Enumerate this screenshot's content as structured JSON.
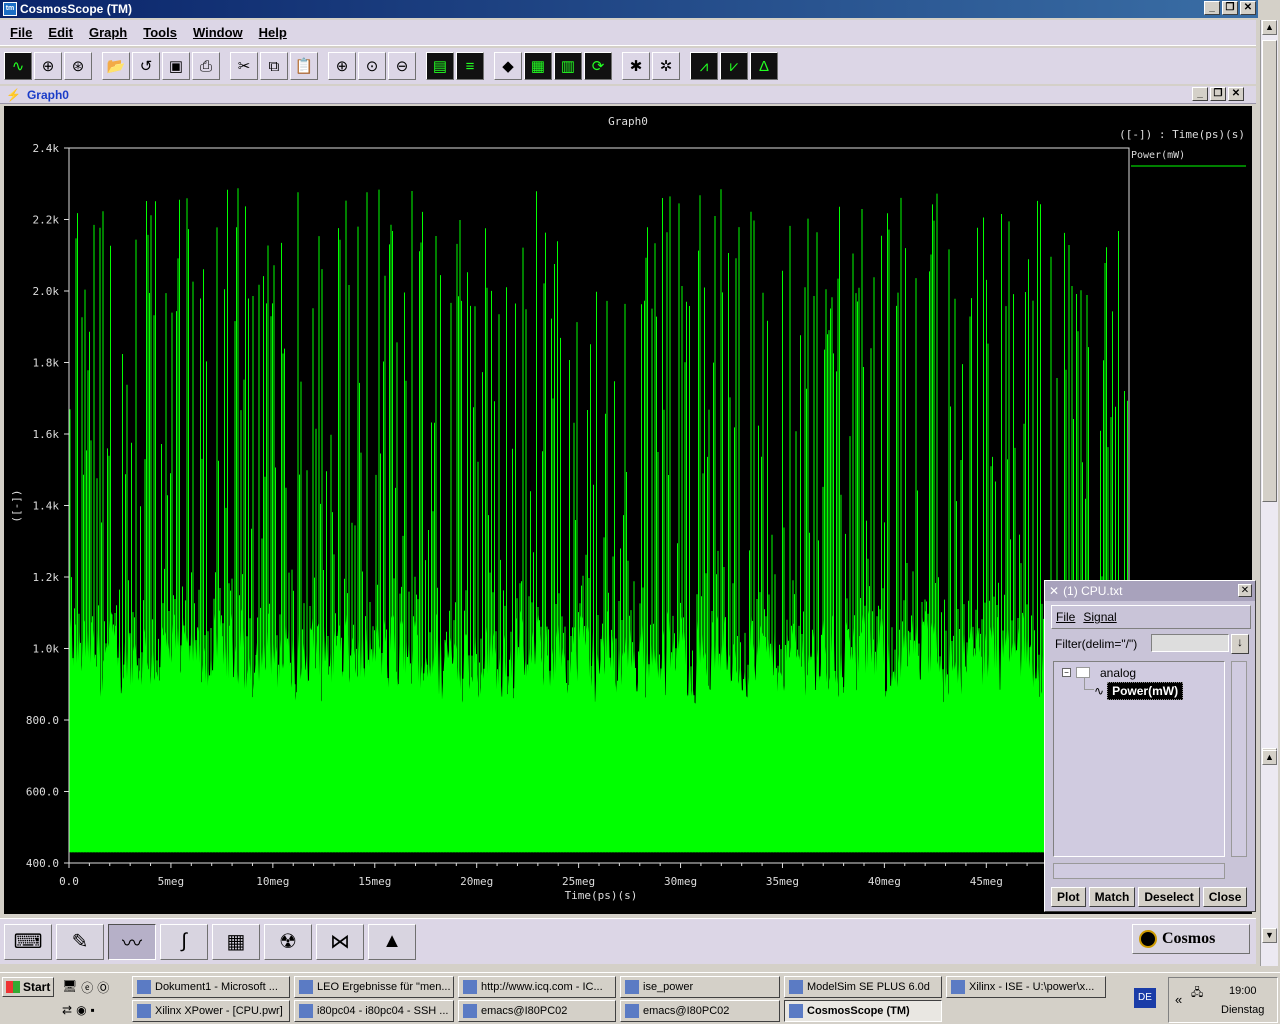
{
  "app": {
    "title": "CosmosScope (TM)",
    "icon_label": "tm"
  },
  "menu": [
    "File",
    "Edit",
    "Graph",
    "Tools",
    "Window",
    "Help"
  ],
  "toolbar": {
    "icons": [
      "wave-icon",
      "crosshair-icon",
      "crosshair2-icon",
      "open-icon",
      "reload-icon",
      "save-icon",
      "print-icon",
      "cut-icon",
      "copy-icon",
      "paste-icon",
      "zoom-in-icon",
      "zoom-fit-icon",
      "zoom-out-icon",
      "layers-icon",
      "stack-icon",
      "diamond-icon",
      "grid-icon",
      "bars-icon",
      "refresh-icon",
      "bug-icon",
      "bug2-icon",
      "measure-icon",
      "measure2-icon",
      "measure3-icon"
    ]
  },
  "graph_window": {
    "title": "Graph0"
  },
  "chart_data": {
    "type": "line",
    "title": "Graph0",
    "xlabel": "Time(ps)(s)",
    "ylabel": "([-])",
    "xlim": [
      0,
      52
    ],
    "ylim": [
      400,
      2400
    ],
    "x_ticks": [
      "0.0",
      "5meg",
      "10meg",
      "15meg",
      "20meg",
      "25meg",
      "30meg",
      "35meg",
      "40meg",
      "45meg",
      "50meg"
    ],
    "y_ticks": [
      "400.0",
      "600.0",
      "800.0",
      "1.0k",
      "1.2k",
      "1.4k",
      "1.6k",
      "1.8k",
      "2.0k",
      "2.2k",
      "2.4k"
    ],
    "legend_header": "([-]) : Time(ps)(s)",
    "series": [
      {
        "name": "Power(mW)",
        "color": "#00ff00",
        "baseline": 430,
        "floor_min": 840,
        "floor_max": 1120,
        "peak_min": 1950,
        "peak_max": 2290,
        "x_end": 52
      }
    ],
    "grid": false,
    "legend_position": "top-right"
  },
  "cpu_window": {
    "title": "(1) CPU.txt",
    "menu": [
      "File",
      "Signal"
    ],
    "filter_label": "Filter(delim=\"/\")",
    "filter_value": "",
    "tree_root": "analog",
    "tree_signal": "Power(mW)",
    "buttons": [
      "Plot",
      "Match",
      "Deselect",
      "Close"
    ]
  },
  "bottom_tools": [
    "keyboard-icon",
    "annotate-icon",
    "waveform-icon",
    "scope-icon",
    "calculator-icon",
    "radiation-icon",
    "flow-icon",
    "matlab-icon"
  ],
  "bottom_logo": "Cosmos",
  "taskbar": {
    "start": "Start",
    "tasks_row1": [
      "Dokument1 - Microsoft ...",
      "LEO Ergebnisse für \"men...",
      "http://www.icq.com - IC...",
      "ise_power",
      "ModelSim SE PLUS 6.0d",
      "Xilinx - ISE - U:\\power\\x..."
    ],
    "tasks_row2": [
      "Xilinx XPower - [CPU.pwr]",
      "i80pc04 - i80pc04 - SSH ...",
      "emacs@I80PC02",
      "emacs@I80PC02",
      "CosmosScope (TM)"
    ],
    "active_task": "CosmosScope (TM)",
    "lang": "DE",
    "time": "19:00",
    "day": "Dienstag"
  }
}
